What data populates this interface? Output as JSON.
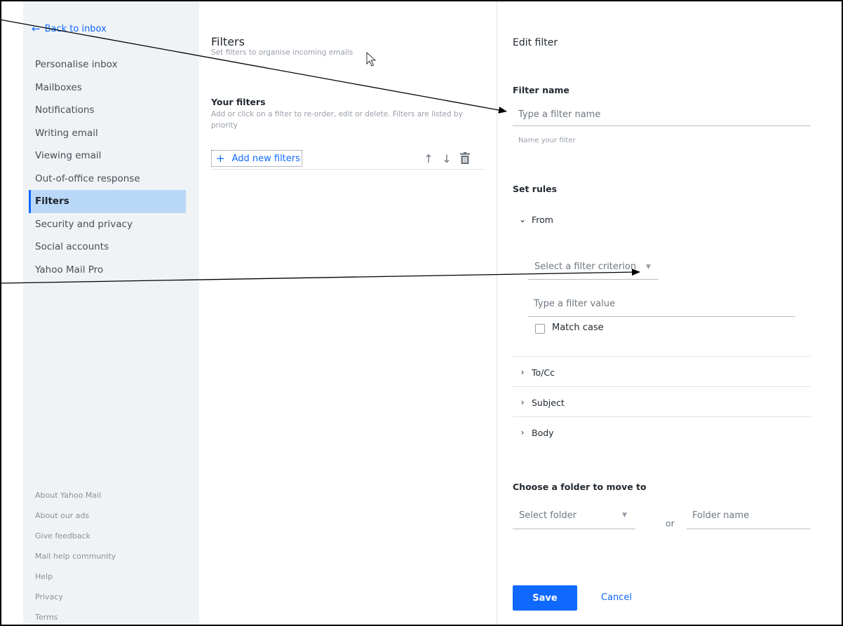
{
  "sidebar": {
    "back_label": "Back to inbox",
    "items": [
      {
        "label": "Personalise inbox"
      },
      {
        "label": "Mailboxes"
      },
      {
        "label": "Notifications"
      },
      {
        "label": "Writing email"
      },
      {
        "label": "Viewing email"
      },
      {
        "label": "Out-of-office response"
      },
      {
        "label": "Filters",
        "active": true
      },
      {
        "label": "Security and privacy"
      },
      {
        "label": "Social accounts"
      },
      {
        "label": "Yahoo Mail Pro"
      }
    ],
    "footer": [
      {
        "label": "About Yahoo Mail"
      },
      {
        "label": "About our ads"
      },
      {
        "label": "Give feedback"
      },
      {
        "label": "Mail help community"
      },
      {
        "label": "Help"
      },
      {
        "label": "Privacy"
      },
      {
        "label": "Terms"
      }
    ]
  },
  "filters_panel": {
    "title": "Filters",
    "subtitle": "Set filters to organise incoming emails",
    "your_filters_title": "Your filters",
    "your_filters_desc": "Add or click on a filter to re-order, edit or delete. Filters are listed by priority",
    "add_label": "Add new filters",
    "add_glyph": "+",
    "up_glyph": "↑",
    "down_glyph": "↓"
  },
  "edit_panel": {
    "title": "Edit filter",
    "filter_name_heading": "Filter name",
    "filter_name_placeholder": "Type a filter name",
    "filter_name_value": "",
    "filter_name_hint": "Name your filter",
    "set_rules_heading": "Set rules",
    "rules": [
      {
        "label": "From",
        "expanded": true,
        "chevron": "⌄"
      },
      {
        "label": "To/Cc",
        "expanded": false,
        "chevron": "›"
      },
      {
        "label": "Subject",
        "expanded": false,
        "chevron": "›"
      },
      {
        "label": "Body",
        "expanded": false,
        "chevron": "›"
      }
    ],
    "criterion_placeholder": "Select a filter criterion",
    "value_placeholder": "Type a filter value",
    "value_value": "",
    "match_case_label": "Match case",
    "match_case_checked": false,
    "folder_heading": "Choose a folder to move to",
    "select_folder_placeholder": "Select folder",
    "or_label": "or",
    "folder_name_placeholder": "Folder name",
    "folder_name_value": "",
    "save_label": "Save",
    "cancel_label": "Cancel"
  },
  "colors": {
    "accent": "#0f69ff",
    "sidebar_bg": "#f0f3f5",
    "active_bg": "#b9d8f7",
    "annotation_arrow": "#000000"
  }
}
